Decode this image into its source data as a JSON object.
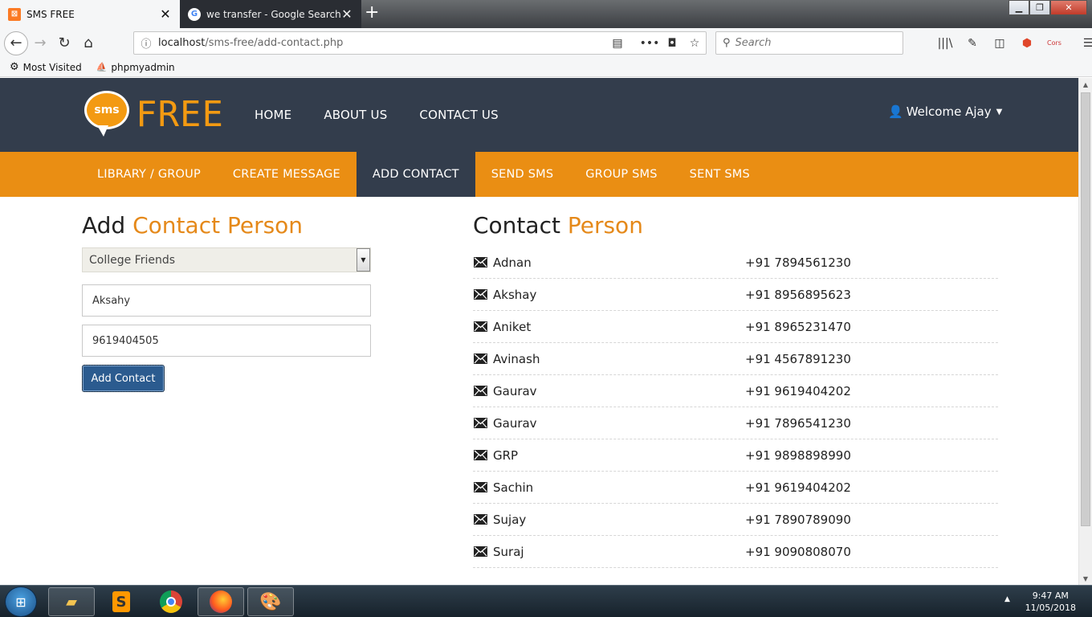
{
  "browser": {
    "tabs": [
      {
        "title": "SMS FREE",
        "active": true
      },
      {
        "title": "we transfer - Google Search",
        "active": false
      }
    ],
    "url_host": "localhost",
    "url_path": "/sms-free/add-contact.php",
    "search_placeholder": "Search",
    "bookmarks": [
      {
        "label": "Most Visited",
        "icon": "gear-icon"
      },
      {
        "label": "phpmyadmin",
        "icon": "pma-icon"
      }
    ]
  },
  "site": {
    "logo_bubble": "sms",
    "logo_text": "FREE",
    "main_nav": [
      "HOME",
      "ABOUT US",
      "CONTACT US"
    ],
    "welcome": "Welcome Ajay",
    "sub_nav": [
      "LIBRARY / GROUP",
      "CREATE MESSAGE",
      "ADD CONTACT",
      "SEND SMS",
      "GROUP SMS",
      "SENT SMS"
    ],
    "sub_nav_active": "ADD CONTACT",
    "colors": {
      "header": "#333d4c",
      "accent": "#ea8e13",
      "button": "#2b5b8f"
    }
  },
  "form": {
    "heading_plain": "Add",
    "heading_accent": "Contact Person",
    "group_selected": "College Friends",
    "name_value": "Aksahy",
    "phone_value": "9619404505",
    "submit_label": "Add Contact"
  },
  "contact_list": {
    "heading_plain": "Contact",
    "heading_accent": "Person",
    "contacts": [
      {
        "name": "Adnan",
        "phone": "+91 7894561230"
      },
      {
        "name": "Akshay",
        "phone": "+91 8956895623"
      },
      {
        "name": "Aniket",
        "phone": "+91 8965231470"
      },
      {
        "name": "Avinash",
        "phone": "+91 4567891230"
      },
      {
        "name": "Gaurav",
        "phone": "+91 9619404202"
      },
      {
        "name": "Gaurav",
        "phone": "+91 7896541230"
      },
      {
        "name": "GRP",
        "phone": "+91 9898898990"
      },
      {
        "name": "Sachin",
        "phone": "+91 9619404202"
      },
      {
        "name": "Sujay",
        "phone": "+91 7890789090"
      },
      {
        "name": "Suraj",
        "phone": "+91 9090808070"
      }
    ]
  },
  "taskbar": {
    "apps": [
      "file-explorer-icon",
      "sublime-text-icon",
      "chrome-icon",
      "firefox-icon",
      "paint-icon"
    ],
    "time": "9:47 AM",
    "date": "11/05/2018"
  }
}
